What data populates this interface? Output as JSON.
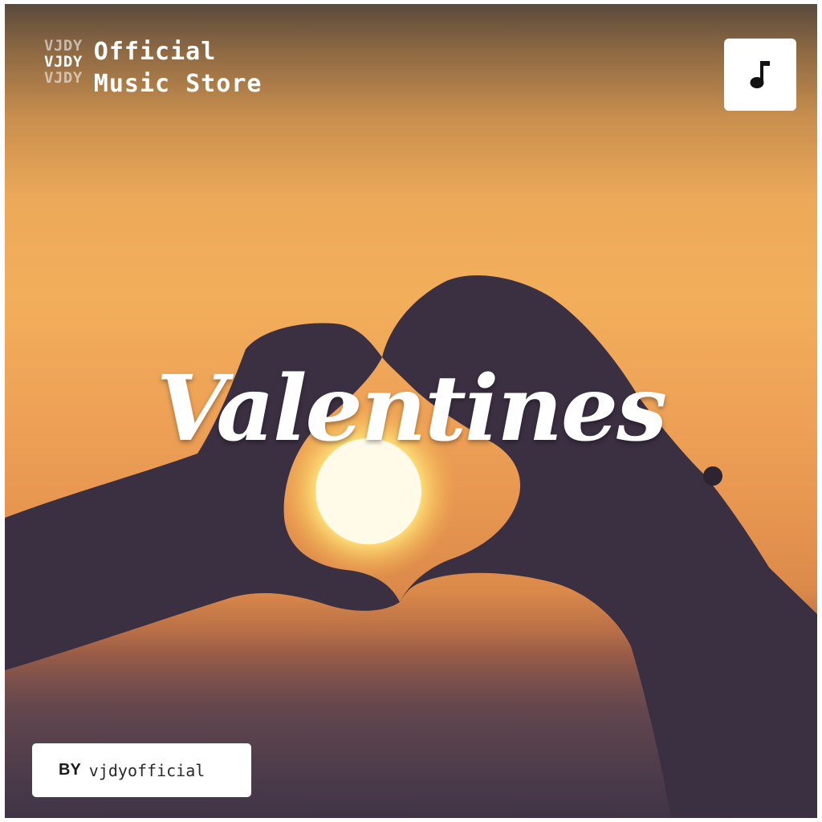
{
  "brand": {
    "mark_lines": [
      "VJDY",
      "VJDY",
      "VJDY"
    ],
    "name_line1": "Official",
    "name_line2": "Music Store"
  },
  "music_button": {
    "icon": "music-note-icon"
  },
  "cover": {
    "title": "Valentines"
  },
  "author": {
    "by_label": "BY",
    "name": "vjdyofficial"
  },
  "colors": {
    "sky_top": "#5a4a3c",
    "sky_mid": "#f2ae5a",
    "sky_bottom": "#4c3c4a",
    "silhouette": "#3b3040",
    "sun": "#fff8d8",
    "card": "#ffffff"
  }
}
